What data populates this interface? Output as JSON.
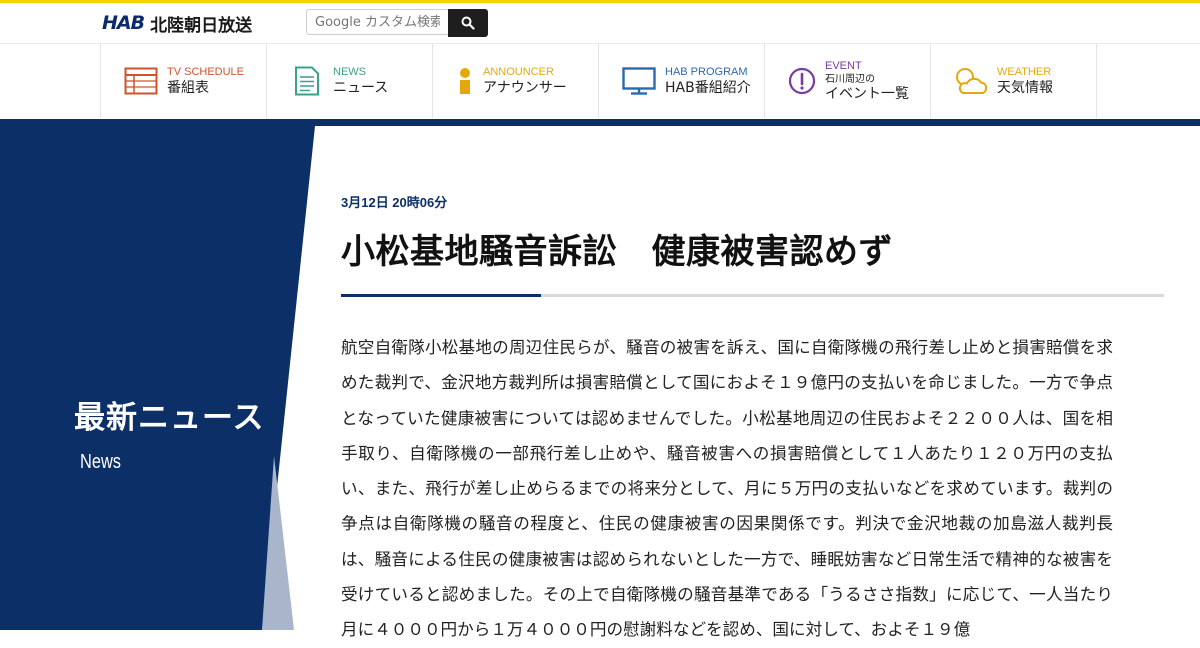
{
  "header": {
    "logo_mark": "HAB",
    "logo_text": "北陸朝日放送",
    "search_placeholder": "Google カスタム検索"
  },
  "nav": {
    "items": [
      {
        "en": "TV SCHEDULE",
        "ja": "番組表",
        "icon": "tv-schedule-icon",
        "color": "#d2522c"
      },
      {
        "en": "NEWS",
        "ja": "ニュース",
        "icon": "news-icon",
        "color": "#3aa18a"
      },
      {
        "en": "ANNOUNCER",
        "ja": "アナウンサー",
        "icon": "announcer-icon",
        "color": "#e3a90c"
      },
      {
        "en": "HAB PROGRAM",
        "ja": "HAB番組紹介",
        "icon": "program-icon",
        "color": "#2a6ab3"
      },
      {
        "en": "EVENT",
        "ja_small": "石川周辺の",
        "ja": "イベント一覧",
        "icon": "event-icon",
        "color": "#7b3aa0"
      },
      {
        "en": "WEATHER",
        "ja": "天気情報",
        "icon": "weather-icon",
        "color": "#e3a90c"
      }
    ]
  },
  "sidebar": {
    "title": "最新ニュース",
    "subtitle": "News"
  },
  "article": {
    "date": "3月12日 20時06分",
    "headline": "小松基地騒音訴訟　健康被害認めず",
    "body": "航空自衛隊小松基地の周辺住民らが、騒音の被害を訴え、国に自衛隊機の飛行差し止めと損害賠償を求めた裁判で、金沢地方裁判所は損害賠償として国におよそ１９億円の支払いを命じました。一方で争点となっていた健康被害については認めませんでした。小松基地周辺の住民およそ２２００人は、国を相手取り、自衛隊機の一部飛行差し止めや、騒音被害への損害賠償として１人あたり１２０万円の支払い、また、飛行が差し止めらるまでの将来分として、月に５万円の支払いなどを求めています。裁判の争点は自衛隊機の騒音の程度と、住民の健康被害の因果関係です。判決で金沢地裁の加島滋人裁判長は、騒音による住民の健康被害は認められないとした一方で、睡眠妨害など日常生活で精神的な被害を受けていると認めました。その上で自衛隊機の騒音基準である「うるささ指数」に応じて、一人当たり月に４０００円から１万４０００円の慰謝料などを認め、国に対して、およそ１９億"
  },
  "colors": {
    "navy": "#0d2f67",
    "accent_yellow": "#f0d400"
  }
}
